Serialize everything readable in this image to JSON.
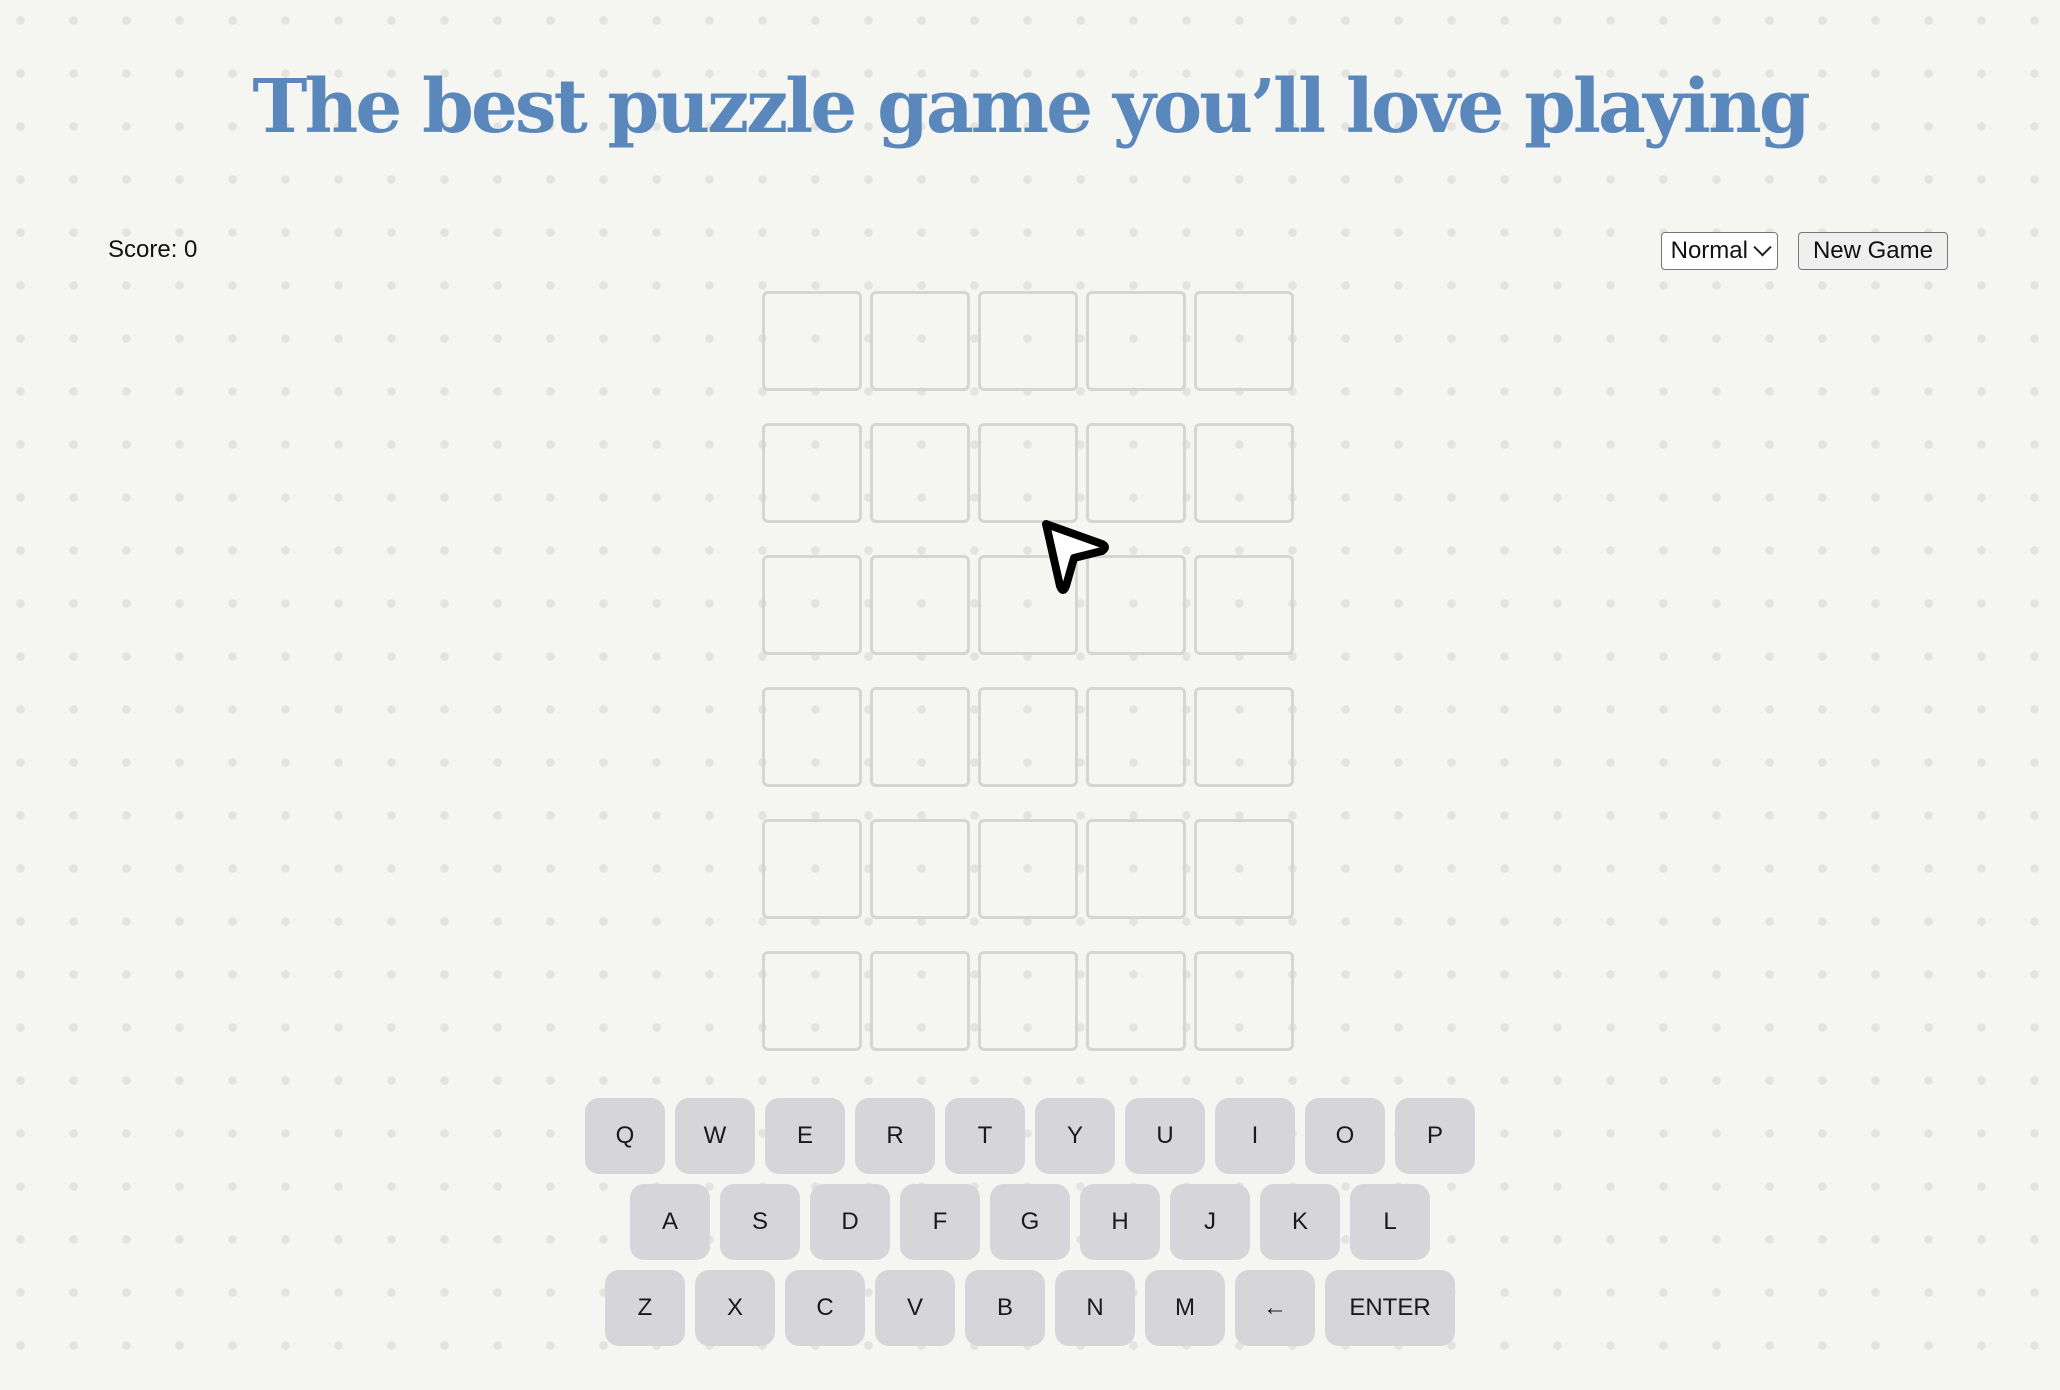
{
  "header": {
    "title": "The best puzzle game you’ll love playing"
  },
  "status": {
    "score_label": "Score: 0"
  },
  "controls": {
    "difficulty_selected": "Normal",
    "new_game_label": "New Game"
  },
  "board": {
    "rows": 6,
    "cols": 5,
    "tiles": [
      [
        "",
        "",
        "",
        "",
        ""
      ],
      [
        "",
        "",
        "",
        "",
        ""
      ],
      [
        "",
        "",
        "",
        "",
        ""
      ],
      [
        "",
        "",
        "",
        "",
        ""
      ],
      [
        "",
        "",
        "",
        "",
        ""
      ],
      [
        "",
        "",
        "",
        "",
        ""
      ]
    ]
  },
  "keyboard": {
    "rows": [
      [
        "Q",
        "W",
        "E",
        "R",
        "T",
        "Y",
        "U",
        "I",
        "O",
        "P"
      ],
      [
        "A",
        "S",
        "D",
        "F",
        "G",
        "H",
        "J",
        "K",
        "L"
      ],
      [
        "Z",
        "X",
        "C",
        "V",
        "B",
        "N",
        "M",
        "←",
        "ENTER"
      ]
    ]
  },
  "icons": {
    "cursor": "arrow-pointer-icon",
    "select_chevron": "chevron-down-icon",
    "backspace": "backspace-arrow-icon"
  },
  "colors": {
    "background": "#f5f5f1",
    "title": "#5a88bd",
    "tile_border": "#d5d5d6",
    "key_bg": "#d6d6da"
  }
}
